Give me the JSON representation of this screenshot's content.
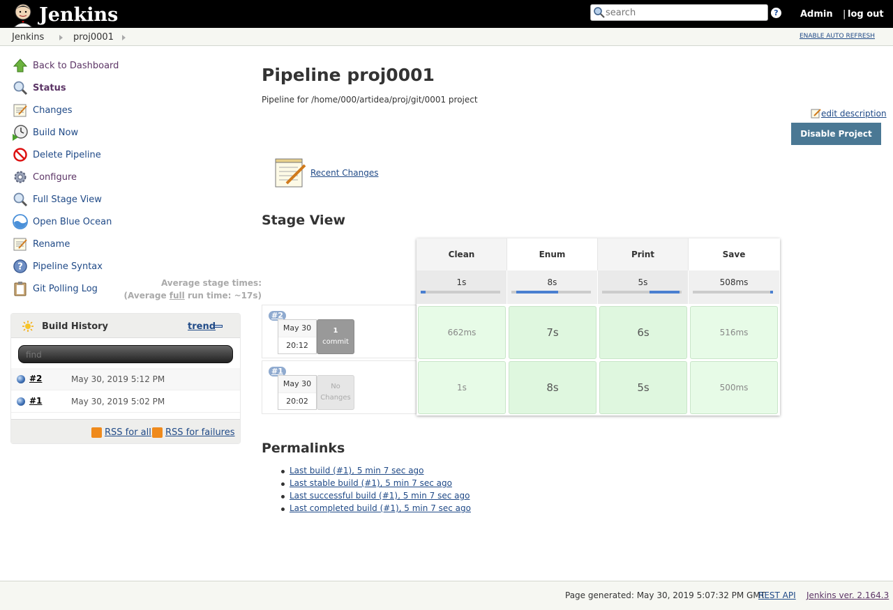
{
  "header": {
    "app_title": "Jenkins",
    "search_placeholder": "search",
    "user": "Admin",
    "logout_sep": "|",
    "logout": "log out"
  },
  "breadcrumbs": [
    "Jenkins",
    "proj0001"
  ],
  "auto_refresh": "ENABLE AUTO REFRESH",
  "sidebar": {
    "tasks": [
      {
        "label": "Back to Dashboard",
        "icon": "arrow-up-icon"
      },
      {
        "label": "Status",
        "icon": "magnifier-icon",
        "active": true
      },
      {
        "label": "Changes",
        "icon": "notepad-icon"
      },
      {
        "label": "Build Now",
        "icon": "clock-play-icon"
      },
      {
        "label": "Delete Pipeline",
        "icon": "no-entry-icon"
      },
      {
        "label": "Configure",
        "icon": "gear-icon"
      },
      {
        "label": "Full Stage View",
        "icon": "magnifier-icon"
      },
      {
        "label": "Open Blue Ocean",
        "icon": "blue-ocean-icon"
      },
      {
        "label": "Rename",
        "icon": "notepad-icon"
      },
      {
        "label": "Pipeline Syntax",
        "icon": "help-icon"
      },
      {
        "label": "Git Polling Log",
        "icon": "clipboard-icon"
      }
    ]
  },
  "build_history": {
    "title": "Build History",
    "trend": "trend",
    "find_placeholder": "find",
    "builds": [
      {
        "num": "#2",
        "date": "May 30, 2019 5:12 PM"
      },
      {
        "num": "#1",
        "date": "May 30, 2019 5:02 PM"
      }
    ],
    "rss_all": "RSS for all",
    "rss_failures": "RSS for failures"
  },
  "main": {
    "title": "Pipeline proj0001",
    "description": "Pipeline for /home/000/artidea/proj/git/0001 project",
    "edit_description": "edit description",
    "disable_button": "Disable Project",
    "recent_changes": "Recent Changes"
  },
  "stage_view": {
    "title": "Stage View",
    "avg_label_1": "Average stage times:",
    "avg_label_2_prefix": "(Average ",
    "avg_label_2_link": "full",
    "avg_label_2_suffix": " run time: ~17s)",
    "stages": [
      {
        "name": "Clean",
        "avg": "1s",
        "bar_start": 0.0,
        "bar_fraction": 0.06
      },
      {
        "name": "Enum",
        "avg": "8s",
        "bar_start": 0.06,
        "bar_fraction": 0.53
      },
      {
        "name": "Print",
        "avg": "5s",
        "bar_start": 0.6,
        "bar_fraction": 0.38
      },
      {
        "name": "Save",
        "avg": "508ms",
        "bar_start": 0.97,
        "bar_fraction": 0.03
      }
    ],
    "runs": [
      {
        "badge": "#2",
        "date": "May 30",
        "time": "20:12",
        "commit_1": "1",
        "commit_2": "commit",
        "has_commits": true,
        "cells": [
          "662ms",
          "7s",
          "6s",
          "516ms"
        ]
      },
      {
        "badge": "#1",
        "date": "May 30",
        "time": "20:02",
        "commit_1": "No",
        "commit_2": "Changes",
        "has_commits": false,
        "cells": [
          "1s",
          "8s",
          "5s",
          "500ms"
        ]
      }
    ]
  },
  "permalinks": {
    "title": "Permalinks",
    "links": [
      "Last build (#1), 5 min 7 sec ago",
      "Last stable build (#1), 5 min 7 sec ago",
      "Last successful build (#1), 5 min 7 sec ago",
      "Last completed build (#1), 5 min 7 sec ago"
    ]
  },
  "footer": {
    "generated": "Page generated: May 30, 2019 5:07:32 PM GMT",
    "rest_api": "REST API",
    "version": "Jenkins ver. 2.164.3"
  }
}
